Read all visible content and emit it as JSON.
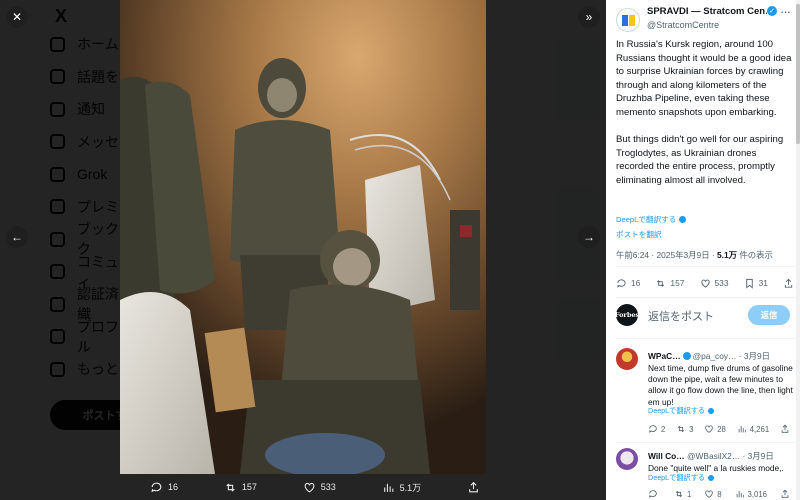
{
  "background": {
    "logo": "X",
    "nav_items": [
      "ホーム",
      "話題を検索",
      "通知",
      "メッセージ",
      "Grok",
      "プレミアム",
      "ブックマーク",
      "コミュニティ",
      "認証済み組織",
      "プロフィール",
      "もっと見る"
    ],
    "post_button": "ポストする"
  },
  "viewer": {
    "photo_description_icon": "photo-icon",
    "media_actions": [
      {
        "icon": "reply-icon",
        "count": "16"
      },
      {
        "icon": "repost-icon",
        "count": "157"
      },
      {
        "icon": "like-icon",
        "count": "533"
      },
      {
        "icon": "views-icon",
        "count": "5.1万"
      },
      {
        "icon": "share-icon",
        "count": ""
      }
    ]
  },
  "tweet": {
    "author": "SPRAVDI — Stratcom Cen…",
    "handle": "@StratcomCentre",
    "paragraph1": "In Russia's Kursk region, around 100 Russians thought it would be a good idea to surprise Ukrainian forces by crawling through and along kilometers of the Druzhba Pipeline, even taking these memento snapshots upon embarking.",
    "paragraph2": "But things didn't go well for our aspiring Troglodytes, as Ukrainian drones recorded the entire process, promptly eliminating almost all involved.",
    "deepl_label": "DeepLで翻訳する",
    "translate_label": "ポストを翻訳",
    "time": "午前6:24 · 2025年3月9日 · ",
    "views": "5.1万",
    "views_suffix": " 件の表示",
    "stats": {
      "replies": "16",
      "reposts": "157",
      "likes": "533",
      "bookmarks": "31"
    }
  },
  "reply_box": {
    "avatar_text": "Forbes",
    "placeholder": "返信をポスト",
    "button": "返信"
  },
  "replies": [
    {
      "name": "WPaC…",
      "handle": "@pa_coy…",
      "date": "· 3月9日",
      "text": "Next time, dump five drums of gasoline down the pipe, wait a few minutes to allow it go flow  down the line, then light em up!",
      "deepl": "DeepLで翻訳する",
      "replies": "2",
      "reposts": "3",
      "likes": "28",
      "views": "4,261",
      "avatar_color": "#c0392b"
    },
    {
      "name": "Will Co…",
      "handle": "@WBasilX2…",
      "date": "· 3月9日",
      "text": "Done \"quite well\" a la ruskies mode,.",
      "deepl": "DeepLで翻訳する",
      "replies": "",
      "reposts": "1",
      "likes": "8",
      "views": "3,016",
      "avatar_color": "#7b4ea3"
    }
  ],
  "colors": {
    "accent": "#1d9bf0",
    "reply_button": "#8ecdf8",
    "text": "#0f1419",
    "muted": "#536471"
  }
}
